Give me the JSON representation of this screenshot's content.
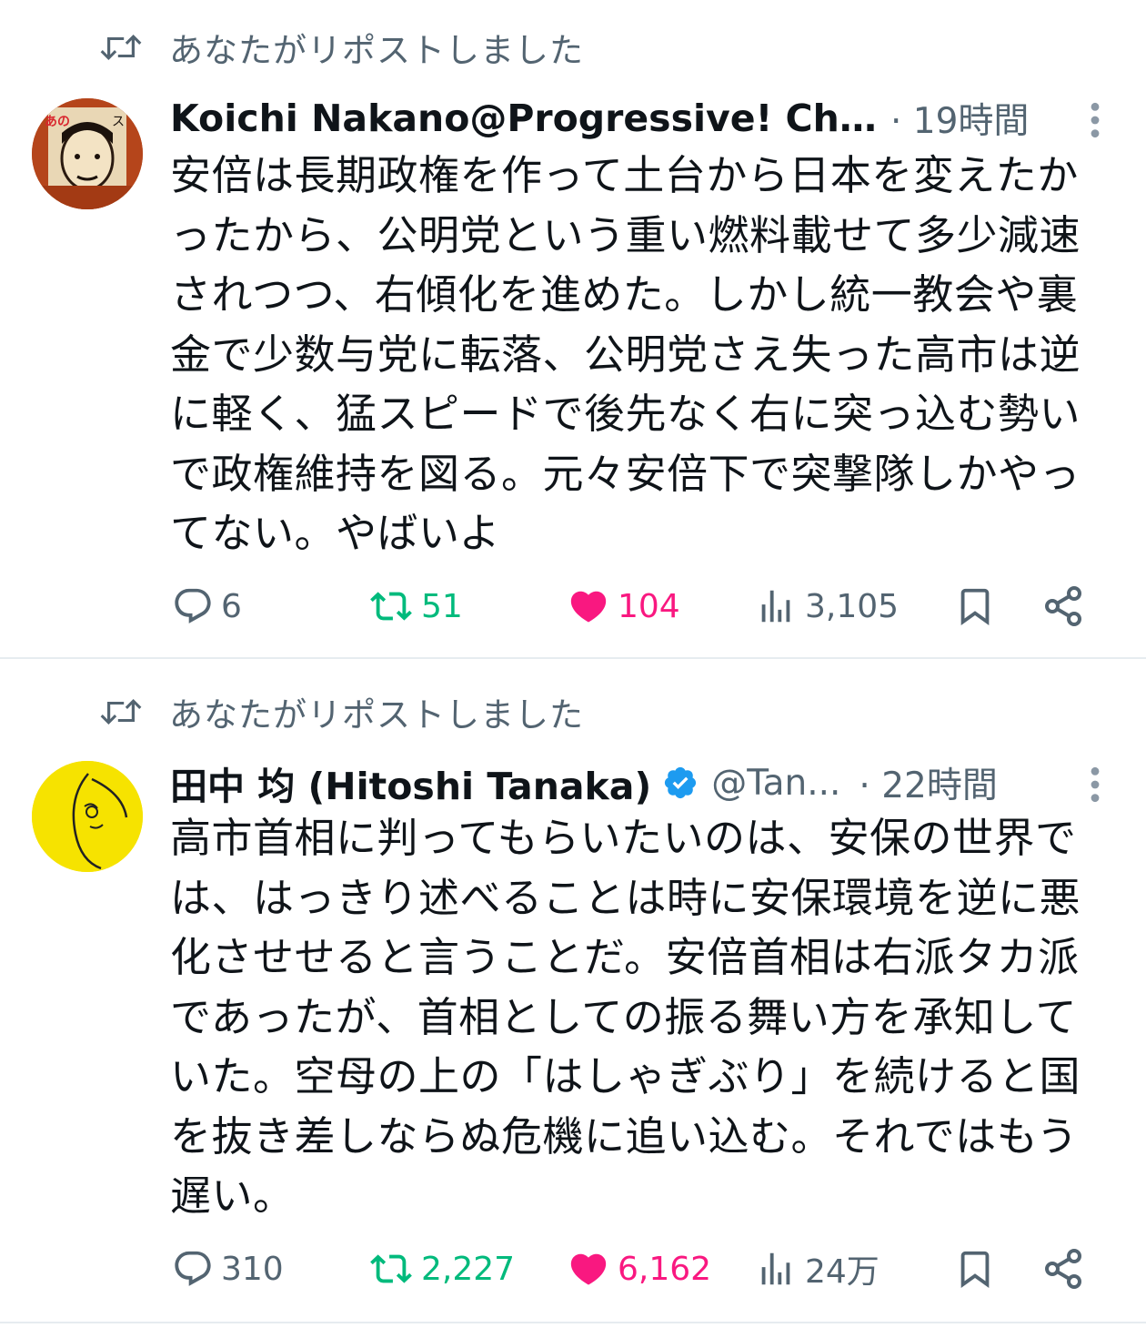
{
  "tweets": [
    {
      "repost_label": "あなたがリポストしました",
      "author_name": "Koichi Nakano@Progressive! Ch...",
      "handle": "",
      "time": "· 19時間",
      "verified": false,
      "text": "安倍は長期政権を作って土台から日本を変えたかったから、公明党という重い燃料載せて多少減速されつつ、右傾化を進めた。しかし統一教会や裏金で少数与党に転落、公明党さえ失った高市は逆に軽く、猛スピードで後先なく右に突っ込む勢いで政権維持を図る。元々安倍下で突撃隊しかやってない。やばいよ",
      "replies": "6",
      "reposts": "51",
      "likes": "104",
      "views": "3,105",
      "reposted_by_you": true,
      "liked": true
    },
    {
      "repost_label": "あなたがリポストしました",
      "author_name": "田中 均 (Hitoshi Tanaka)",
      "handle": "@Tan...",
      "time": "· 22時間",
      "verified": true,
      "text": "高市首相に判ってもらいたいのは、安保の世界では、はっきり述べることは時に安保環境を逆に悪化させせると言うことだ。安倍首相は右派タカ派であったが、首相としての振る舞い方を承知していた。空母の上の「はしゃぎぶり」を続けると国を抜き差しならぬ危機に追い込む。それではもう遅い。",
      "replies": "310",
      "reposts": "2,227",
      "likes": "6,162",
      "views": "24万",
      "reposted_by_you": true,
      "liked": true
    }
  ],
  "colors": {
    "text": "#0f1419",
    "secondary": "#536471",
    "retweet_green": "#00ba7c",
    "like_pink": "#f91880",
    "verified_blue": "#1d9bf0",
    "divider": "#e6ecf0"
  },
  "icons": {
    "repost": "repost-icon",
    "reply": "reply-icon",
    "like": "heart-icon",
    "views": "views-icon",
    "bookmark": "bookmark-icon",
    "share": "share-icon",
    "more": "more-icon",
    "verified": "verified-badge-icon"
  }
}
